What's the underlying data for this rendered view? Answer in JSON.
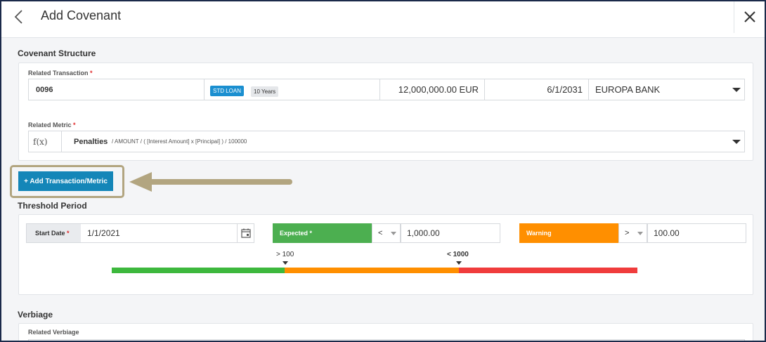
{
  "header": {
    "title": "Add Covenant"
  },
  "covenant_structure": {
    "title": "Covenant Structure",
    "related_transaction": {
      "label": "Related Transaction",
      "required_mark": "*",
      "id": "0096",
      "type_tag": "STD LOAN",
      "term_tag": "10 Years",
      "amount": "12,000,000.00 EUR",
      "date": "6/1/2031",
      "bank": "EUROPA BANK"
    },
    "related_metric": {
      "label": "Related Metric",
      "required_mark": "*",
      "fx_symbol": "f(x)",
      "name": "Penalties",
      "formula": "/ AMOUNT / ( [Interest Amount] x [Principal] ) / 100000"
    },
    "add_button_label": "+ Add Transaction/Metric"
  },
  "threshold_period": {
    "title": "Threshold Period",
    "start_date_label": "Start Date",
    "required_mark": "*",
    "start_date_value": "1/1/2021",
    "expected": {
      "label": "Expected *",
      "operator": "<",
      "value": "1,000.00"
    },
    "warning": {
      "label": "Warning",
      "operator": ">",
      "value": "100.00"
    },
    "scale": {
      "marker_low": "> 100",
      "marker_high": "< 1000",
      "colors": {
        "green": "#3db83d",
        "orange": "#ff8f00",
        "red": "#f03c3c"
      }
    }
  },
  "verbiage": {
    "title": "Verbiage",
    "related_label": "Related Verbiage"
  },
  "colors": {
    "accent": "#1486b8",
    "highlight_outline": "#b2a580",
    "expected_green": "#4caf50",
    "warning_orange": "#ff8f00",
    "frame_border": "#1b2a4a"
  },
  "icons": [
    "back-icon",
    "close-icon",
    "calendar-icon",
    "dropdown-caret-icon",
    "fx-icon",
    "annotation-arrow-icon"
  ]
}
